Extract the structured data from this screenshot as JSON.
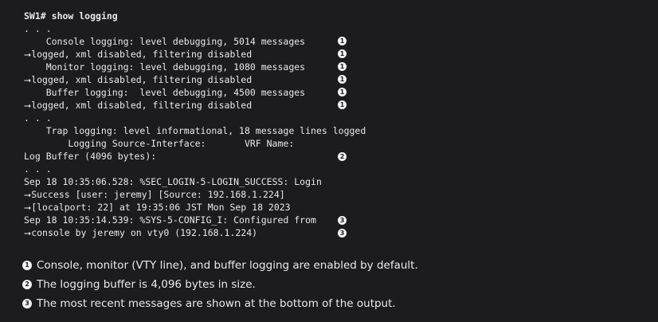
{
  "terminal": {
    "prompt": "SW1#",
    "command": "show logging",
    "lines": [
      ". . .",
      "    Console logging: level debugging, 5014 messages",
      "⭢logged, xml disabled, filtering disabled",
      "    Monitor logging: level debugging, 1080 messages",
      "⭢logged, xml disabled, filtering disabled",
      "    Buffer logging:  level debugging, 4500 messages",
      "⭢logged, xml disabled, filtering disabled",
      ". . .",
      "    Trap logging: level informational, 18 message lines logged",
      "        Logging Source-Interface:       VRF Name:",
      "Log Buffer (4096 bytes):",
      ". . .",
      "Sep 18 10:35:06.528: %SEC_LOGIN-5-LOGIN_SUCCESS: Login",
      "⭢Success [user: jeremy] [Source: 192.168.1.224]",
      "⭢[localport: 22] at 19:35:06 JST Mon Sep 18 2023",
      "Sep 18 10:35:14.539: %SYS-5-CONFIG_I: Configured from",
      "⭢console by jeremy on vty0 (192.168.1.224)"
    ],
    "callouts": [
      "1",
      "1",
      "1",
      "1",
      "1",
      "1",
      "2",
      "3",
      "3"
    ]
  },
  "notes": [
    {
      "badge": "1",
      "text": "Console, monitor (VTY line), and buffer logging are enabled by default."
    },
    {
      "badge": "2",
      "text": "The logging buffer is 4,096 bytes in size."
    },
    {
      "badge": "3",
      "text": "The most recent messages are shown at the bottom of the output."
    }
  ]
}
